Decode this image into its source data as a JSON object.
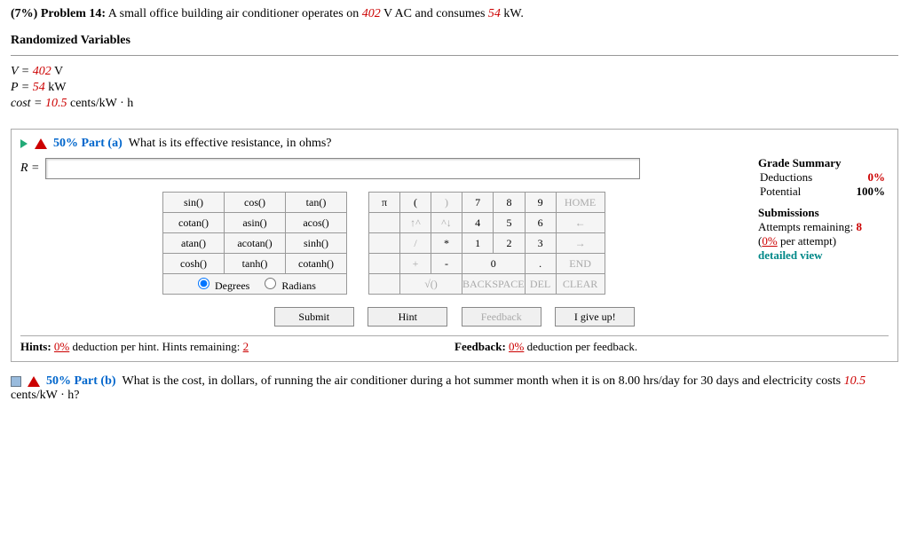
{
  "problem": {
    "weight": "(7%)",
    "number_label": "Problem 14:",
    "text_1": "A small office building air conditioner operates on ",
    "voltage": "402",
    "text_2": " V AC and consumes ",
    "power": "54",
    "text_3": " kW."
  },
  "rand_vars": {
    "title": "Randomized Variables",
    "v_prefix": "V = ",
    "v_val": "402",
    "v_unit": " V",
    "p_prefix": "P = ",
    "p_val": "54",
    "p_unit": " kW",
    "c_prefix": "cost = ",
    "c_val": "10.5",
    "c_unit": " cents/kW · h"
  },
  "part_a": {
    "pct": "50%",
    "label": "Part (a)",
    "question": "What is its effective resistance, in ohms?",
    "answer_prefix": "R = ",
    "answer_value": ""
  },
  "grade": {
    "title": "Grade Summary",
    "ded_label": "Deductions",
    "ded_val": "0%",
    "pot_label": "Potential",
    "pot_val": "100%"
  },
  "subs": {
    "title": "Submissions",
    "attempts_label": "Attempts remaining: ",
    "attempts_val": "8",
    "per_attempt": "(0% per attempt)",
    "detailed": "detailed view"
  },
  "funcs": {
    "r1": [
      "sin()",
      "cos()",
      "tan()"
    ],
    "r2": [
      "cotan()",
      "asin()",
      "acos()"
    ],
    "r3": [
      "atan()",
      "acotan()",
      "sinh()"
    ],
    "r4": [
      "cosh()",
      "tanh()",
      "cotanh()"
    ],
    "degrees": "Degrees",
    "radians": "Radians"
  },
  "nums": {
    "pi": "π",
    "lp": "(",
    "rp": ")",
    "home": "HOME",
    "end": "END",
    "back": "BACKSPACE",
    "del": "DEL",
    "clear": "CLEAR",
    "up": "↑^",
    "dn": "^↓",
    "slash": "/",
    "star": "*",
    "plus": "+",
    "minus": "-",
    "dot": ".",
    "sqrt": "√()",
    "larr": "←",
    "rarr": "→",
    "n0": "0",
    "n1": "1",
    "n2": "2",
    "n3": "3",
    "n4": "4",
    "n5": "5",
    "n6": "6",
    "n7": "7",
    "n8": "8",
    "n9": "9"
  },
  "actions": {
    "submit": "Submit",
    "hint": "Hint",
    "feedback": "Feedback",
    "giveup": "I give up!"
  },
  "hints": {
    "left_1": "Hints: ",
    "left_ded": "0%",
    "left_2": " deduction per hint. Hints remaining: ",
    "left_rem": "2",
    "right_1": "Feedback: ",
    "right_ded": "0%",
    "right_2": " deduction per feedback."
  },
  "part_b": {
    "pct": "50%",
    "label": "Part (b)",
    "q1": "What is the cost, in dollars, of running the air conditioner during a hot summer month when it is on 8.00 hrs/day for 30 days and electricity costs ",
    "cost": "10.5",
    "q2": " cents/kW · h?"
  }
}
